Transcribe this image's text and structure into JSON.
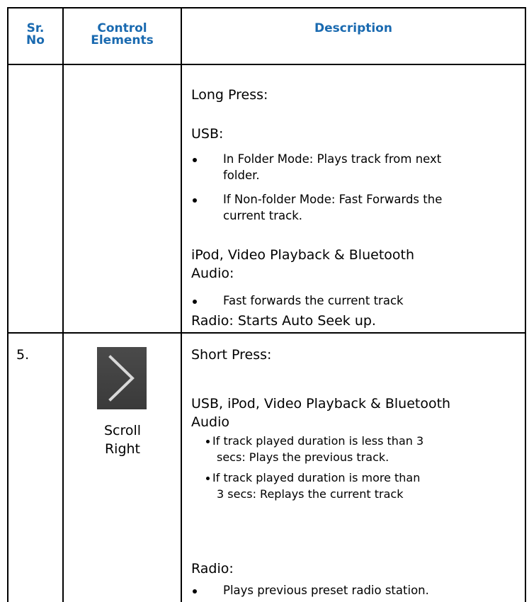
{
  "header": {
    "sr_no_line1": "Sr.",
    "sr_no_line2": "No",
    "control_line1": "Control",
    "control_line2": "Elements",
    "description": "Description"
  },
  "row_prev": {
    "long_press": "Long Press:",
    "usb_title": "USB:",
    "usb_items": [
      {
        "line1": "In Folder Mode: Plays track from next",
        "line2": "folder."
      },
      {
        "line1": "If Non-folder Mode: Fast Forwards the",
        "line2": "current track."
      }
    ],
    "ipod_title_line1": "iPod, Video Playback & Bluetooth",
    "ipod_title_line2": "Audio:",
    "ipod_items": [
      "Fast forwards the current track"
    ],
    "radio": "Radio: Starts Auto Seek up."
  },
  "row5": {
    "sr_no": "5.",
    "icon": "chevron-right-icon",
    "control_line1": "Scroll",
    "control_line2": "Right",
    "short_press": "Short Press:",
    "usb_title_line1": "USB, iPod, Video Playback & Bluetooth",
    "usb_title_line2": "Audio",
    "usb_items": [
      {
        "line1": "If track played duration is less than 3",
        "line2": "secs: Plays the previous track."
      },
      {
        "line1": "If track played duration is more than",
        "line2": "3 secs: Replays the current track"
      }
    ],
    "radio_title": "Radio:",
    "radio_items": [
      "Plays previous preset radio station."
    ]
  },
  "colors": {
    "header_text": "#1a6ab0",
    "icon_bg": "#404040",
    "icon_stroke": "#d8d8d8"
  }
}
